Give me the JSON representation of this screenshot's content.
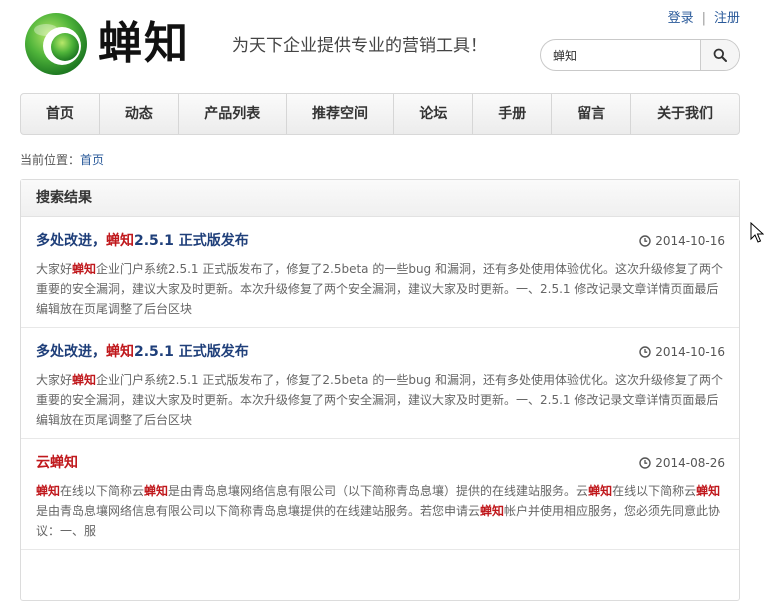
{
  "header": {
    "logo_text": "蝉知",
    "slogan": "为天下企业提供专业的营销工具！",
    "login": "登录",
    "register": "注册",
    "search_value": "蝉知",
    "search_icon": "search-icon"
  },
  "nav": {
    "items": [
      {
        "label": "首页"
      },
      {
        "label": "动态"
      },
      {
        "label": "产品列表"
      },
      {
        "label": "推荐空间"
      },
      {
        "label": "论坛"
      },
      {
        "label": "手册"
      },
      {
        "label": "留言"
      },
      {
        "label": "关于我们"
      }
    ]
  },
  "breadcrumb": {
    "prefix": "当前位置：",
    "home": "首页"
  },
  "results": {
    "heading": "搜索结果",
    "items": [
      {
        "title_parts": [
          "多处改进，",
          "蝉知",
          "2.5.1 正式版发布"
        ],
        "date": "2014-10-16",
        "desc_parts": [
          "大家好",
          "蝉知",
          "企业门户系统2.5.1 正式版发布了，修复了2.5beta 的一些bug 和漏洞，还有多处使用体验优化。这次升级修复了两个重要的安全漏洞，建议大家及时更新。本次升级修复了两个安全漏洞，建议大家及时更新。一、2.5.1 修改记录文章详情页面最后编辑放在页尾调整了后台区块"
        ]
      },
      {
        "title_parts": [
          "多处改进，",
          "蝉知",
          "2.5.1 正式版发布"
        ],
        "date": "2014-10-16",
        "desc_parts": [
          "大家好",
          "蝉知",
          "企业门户系统2.5.1 正式版发布了，修复了2.5beta 的一些bug 和漏洞，还有多处使用体验优化。这次升级修复了两个重要的安全漏洞，建议大家及时更新。本次升级修复了两个安全漏洞，建议大家及时更新。一、2.5.1 修改记录文章详情页面最后编辑放在页尾调整了后台区块"
        ]
      },
      {
        "title_parts": [
          "云",
          "蝉知",
          ""
        ],
        "date": "2014-08-26",
        "desc_parts": [
          "",
          "蝉知",
          "在线以下简称云",
          "蝉知",
          "是由青岛息壤网络信息有限公司（以下简称青岛息壤）提供的在线建站服务。云",
          "蝉知",
          "在线以下简称云",
          "蝉知",
          "是由青岛息壤网络信息有限公司以下简称青岛息壤提供的在线建站服务。若您申请云",
          "蝉知",
          "帐户并使用相应服务，您必须先同意此协议：一、服"
        ]
      }
    ]
  },
  "colors": {
    "accent": "#1f3f7a",
    "highlight": "#c0181c",
    "logo_green": "#3fa63a"
  }
}
